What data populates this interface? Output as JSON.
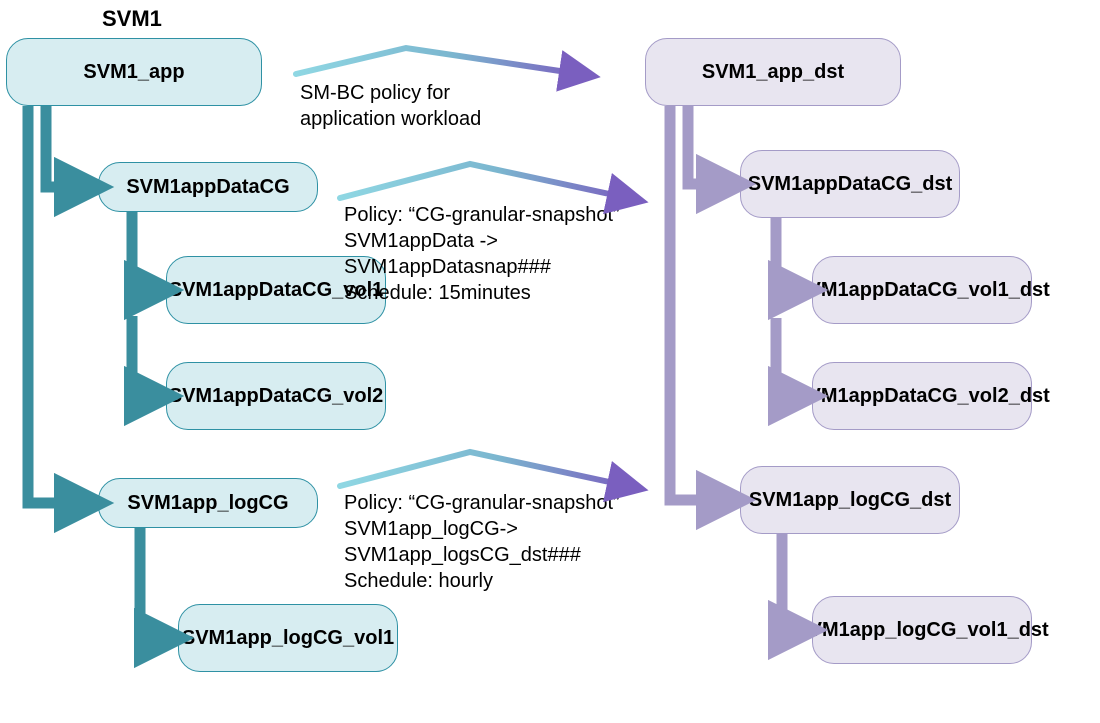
{
  "heading": "SVM1",
  "source": {
    "root": "SVM1_app",
    "dataCG": "SVM1appDataCG",
    "dataVol1": "SVM1appDataCG_vol1",
    "dataVol2": "SVM1appDataCG_vol2",
    "logCG": "SVM1app_logCG",
    "logVol1": "SVM1app_logCG_vol1"
  },
  "dest": {
    "root": "SVM1_app_dst",
    "dataCG": "SVM1appDataCG_dst",
    "dataVol1": "SVM1appDataCG_vol1_dst",
    "dataVol2": "SVM1appDataCG_vol2_dst",
    "logCG": "SVM1app_logCG_dst",
    "logVol1": "SVM1app_logCG_vol1_dst"
  },
  "policies": {
    "app": {
      "l1": "SM-BC policy for",
      "l2": "application workload"
    },
    "data": {
      "l1": "Policy: “CG-granular-snapshot”",
      "l2": "SVM1appData ->",
      "l3": "SVM1appDatasnap###",
      "l4": "Schedule: 15minutes"
    },
    "log": {
      "l1": "Policy: “CG-granular-snapshot”",
      "l2": "SVM1app_logCG->",
      "l3": "SVM1app_logsCG_dst###",
      "l4": "Schedule: hourly"
    }
  },
  "colors": {
    "srcFill": "#D7EDF1",
    "srcStroke": "#2E91A4",
    "srcArrow": "#3A8E9E",
    "dstFill": "#E8E5F0",
    "dstStroke": "#A49BC7",
    "dstArrow": "#A49BC7",
    "gradStart": "#7FD0DC",
    "gradEnd": "#7A5FBF"
  }
}
